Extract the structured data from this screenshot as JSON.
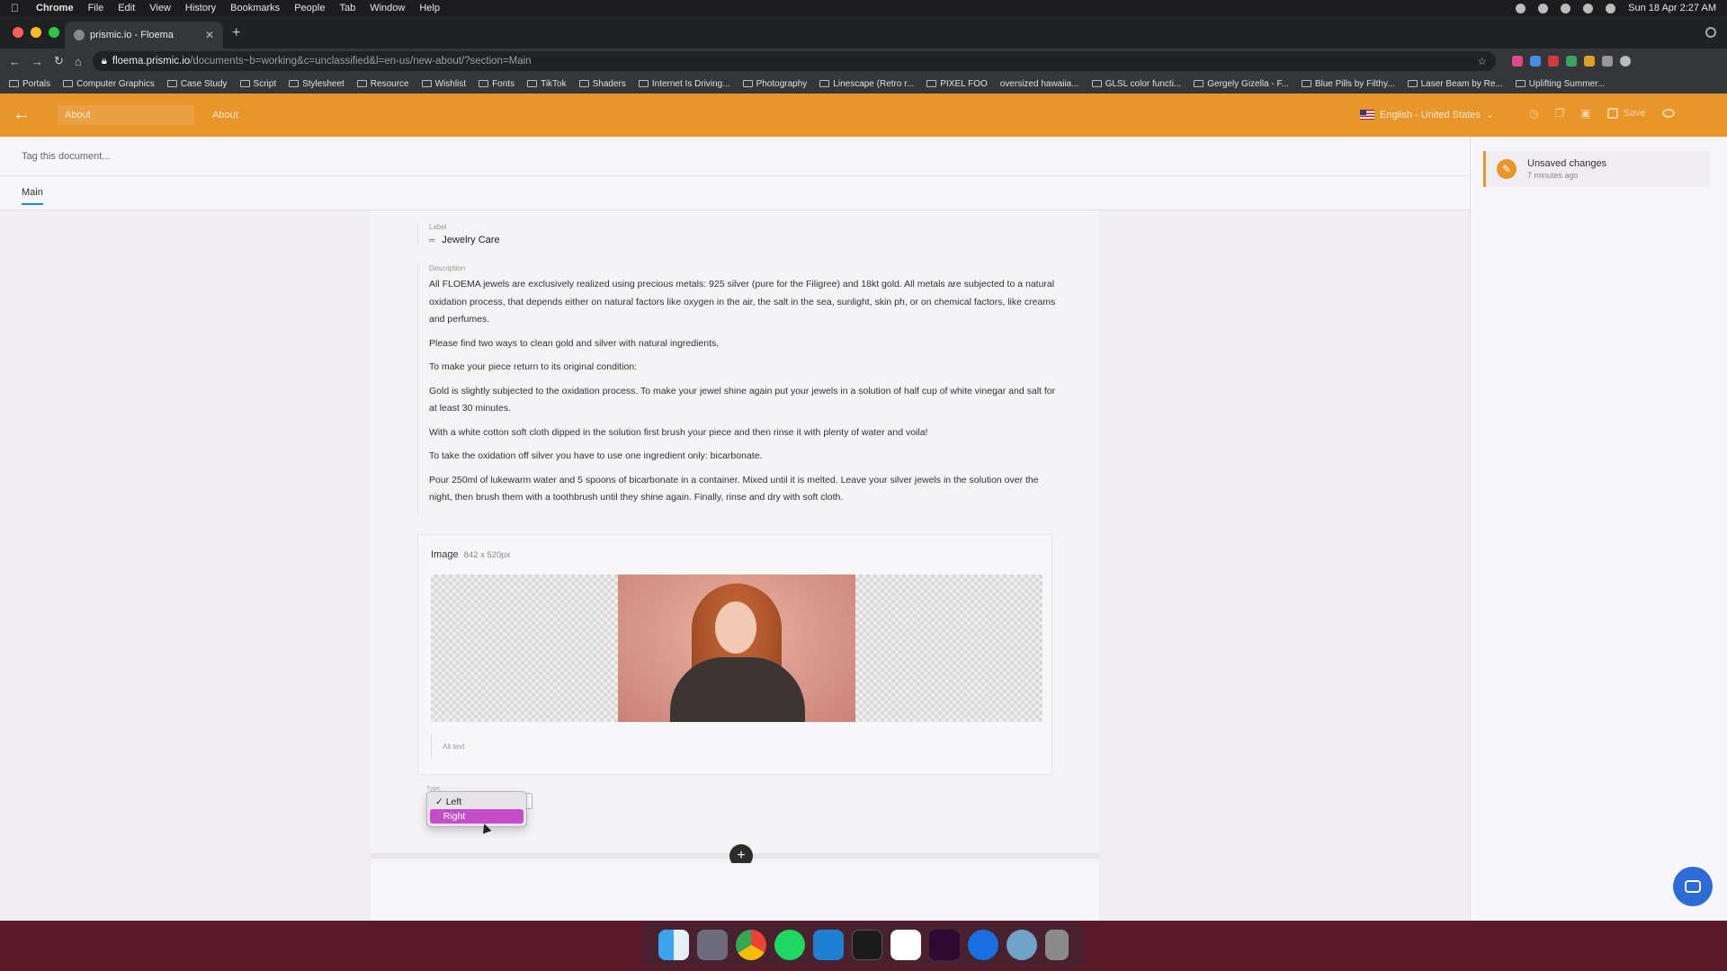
{
  "menubar": {
    "app_name": "Chrome",
    "items": [
      "File",
      "Edit",
      "View",
      "History",
      "Bookmarks",
      "People",
      "Tab",
      "Window",
      "Help"
    ],
    "datetime": "Sun 18 Apr  2:27 AM"
  },
  "browser": {
    "tab_title": "prismic.io - Floema",
    "url_host": "floema.prismic.io",
    "url_path": "/documents~b=working&c=unclassified&l=en-us/new-about/?section=Main",
    "bookmarks": [
      "Portals",
      "Computer Graphics",
      "Case Study",
      "Script",
      "Stylesheet",
      "Resource",
      "Wishlist",
      "Fonts",
      "TikTok",
      "Shaders",
      "Internet Is Driving...",
      "Photography",
      "Linescape (Retro r...",
      "PIXEL FOO",
      "oversized hawaiia...",
      "GLSL color functi...",
      "Gergely Gizella - F...",
      "Blue Pills by Filthy...",
      "Laser Beam by Re...",
      "Uplifting Summer..."
    ]
  },
  "topbar": {
    "breadcrumb_input": "About",
    "breadcrumb_title": "About",
    "language": "English - United States",
    "save_label": "Save"
  },
  "document": {
    "tag_placeholder": "Tag this document...",
    "main_tab": "Main"
  },
  "history": {
    "title": "Unsaved changes",
    "time": "7 minutes ago"
  },
  "fields": {
    "label_caption": "Label",
    "label_value": "Jewelry Care",
    "description_caption": "Description",
    "description_paragraphs": [
      "All FLOEMA jewels are exclusively realized using precious metals: 925 silver (pure for the Filigree) and 18kt gold. All metals are subjected to a natural oxidation process, that depends either on natural factors like oxygen in the air, the salt in the sea, sunlight, skin ph, or on chemical factors, like creams and perfumes.",
      "Please find two ways to clean gold and silver with natural ingredients,",
      "To make your piece return to its original condition:",
      "Gold is slightly subjected to the oxidation process. To make your jewel shine again put your jewels in a solution of half cup of white vinegar and salt for at least 30 minutes.",
      "With a white cotton soft cloth dipped in the solution first brush your piece and then rinse it with plenty of water and voila!",
      "To take the oxidation off silver you have to use one ingredient only: bicarbonate.",
      "Pour 250ml of lukewarm water and 5 spoons of bicarbonate in a container. Mixed until it is melted. Leave your silver jewels in the solution over the night, then brush them with a toothbrush until they shine again. Finally, rinse and dry with soft cloth."
    ],
    "image_title": "Image",
    "image_size": "842 x 520px",
    "alt_placeholder": "Alt text",
    "type_caption": "Type",
    "type_options": [
      "Left",
      "Right"
    ],
    "type_selected": "Left",
    "type_highlighted": "Right"
  },
  "colors": {
    "brand_orange": "#e8952a",
    "option_highlight": "#c44ec9",
    "tab_underline": "#1e88e5"
  }
}
